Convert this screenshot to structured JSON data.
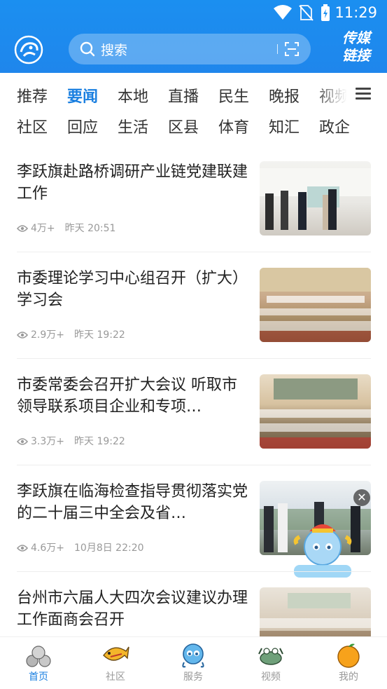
{
  "status_bar": {
    "time": "11:29"
  },
  "header": {
    "search_placeholder": "搜索",
    "media_link_line1": "传媒",
    "media_link_line2": "链接"
  },
  "categories": {
    "row1": [
      "推荐",
      "要闻",
      "本地",
      "直播",
      "民生",
      "晚报",
      "视频"
    ],
    "row2": [
      "社区",
      "回应",
      "生活",
      "区县",
      "体育",
      "知汇",
      "政企"
    ],
    "active": "要闻"
  },
  "news": [
    {
      "title": "李跃旗赴路桥调研产业链党建联建工作",
      "views": "4万+",
      "time": "昨天  20:51"
    },
    {
      "title": "市委理论学习中心组召开（扩大）学习会",
      "views": "2.9万+",
      "time": "昨天  19:22"
    },
    {
      "title": "市委常委会召开扩大会议 听取市领导联系项目企业和专项…",
      "views": "3.3万+",
      "time": "昨天  19:22"
    },
    {
      "title": "李跃旗在临海检查指导贯彻落实党的二十届三中全会及省…",
      "views": "4.6万+",
      "time": "10月8日  22:20"
    },
    {
      "title": "台州市六届人大四次会议建议办理工作面商会召开",
      "views": "",
      "time": ""
    }
  ],
  "tabs": [
    {
      "label": "首页",
      "icon": "home-icon"
    },
    {
      "label": "社区",
      "icon": "community-icon"
    },
    {
      "label": "服务",
      "icon": "service-icon"
    },
    {
      "label": "视频",
      "icon": "video-icon"
    },
    {
      "label": "我的",
      "icon": "profile-icon"
    }
  ],
  "colors": {
    "brand_blue": "#1a7fe0",
    "header_blue": "#1b8ff0"
  }
}
